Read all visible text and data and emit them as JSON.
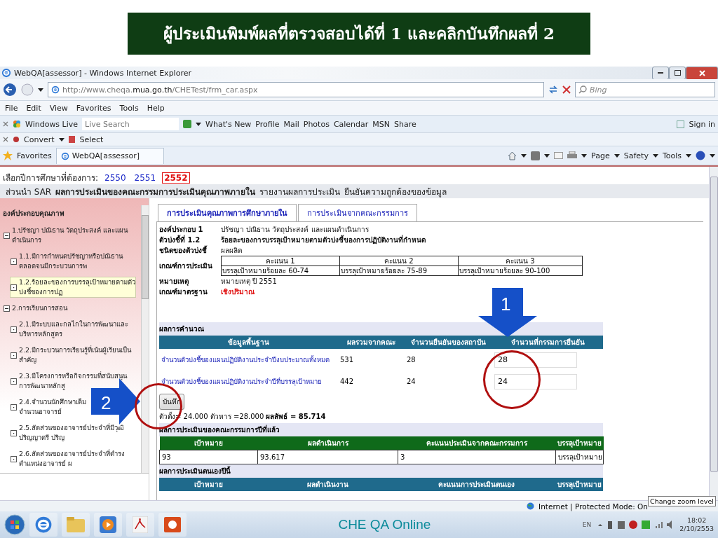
{
  "slide_title": "ผู้ประเมินพิมพ์ผลที่ตรวจสอบได้ที่ 1 และคลิกบันทึกผลที่ 2",
  "window": {
    "title": "WebQA[assessor] - Windows Internet Explorer"
  },
  "address": "http://www.cheqa.**mua.go.th**/CHETest/frm_car.aspx",
  "search": {
    "placeholder": "Bing"
  },
  "menu": [
    "File",
    "Edit",
    "View",
    "Favorites",
    "Tools",
    "Help"
  ],
  "links_bar": {
    "brand": "Windows Live",
    "search_placeholder": "Live Search",
    "links": [
      "What's New",
      "Profile",
      "Mail",
      "Photos",
      "Calendar",
      "MSN",
      "Share"
    ],
    "sign_in": "Sign in"
  },
  "convert_bar": [
    "Convert",
    "Select"
  ],
  "favorites": {
    "label": "Favorites",
    "tab": "WebQA[assessor]"
  },
  "command_bar": [
    "Page",
    "Safety",
    "Tools"
  ],
  "year_picker": {
    "label": "เลือกปีการศึกษาที่ต้องการ:",
    "years": [
      {
        "label": "2550",
        "selected": false
      },
      {
        "label": "2551",
        "selected": false
      },
      {
        "label": "2552",
        "selected": true
      }
    ]
  },
  "nav": [
    {
      "label": "ส่วนนำ SAR",
      "selected": false
    },
    {
      "label": "ผลการประเมินของคณะกรรมการประเมินคุณภาพภายใน",
      "selected": true
    },
    {
      "label": "รายงานผลการประเมิน",
      "selected": false
    },
    {
      "label": "ยืนยันความถูกต้องของข้อมูล",
      "selected": false
    }
  ],
  "sidebar": {
    "heading": "องค์ประกอบคุณภาพ",
    "items": [
      {
        "lines": [
          "1.ปรัชญา ปณิธาน วัตถุประสงค์ และแผน",
          "ดำเนินการ"
        ],
        "expanded": true,
        "children": [
          {
            "lines": [
              "1.1.มีการกำหนดปรัชญาหรือปณิธาน",
              "ตลอดจนมีกระบวนการพ"
            ],
            "selected": false
          },
          {
            "lines": [
              "1.2.ร้อยละของการบรรลุเป้าหมายตามตัว",
              "บ่งชี้ของการปฏ"
            ],
            "selected": true
          }
        ]
      },
      {
        "lines": [
          "2.การเรียนการสอน"
        ],
        "expanded": true,
        "children": [
          {
            "lines": [
              "2.1.มีระบบและกลไกในการพัฒนาและ",
              "บริหารหลักสูตร"
            ],
            "selected": false
          },
          {
            "lines": [
              "2.2.มีกระบวนการเรียนรู้ที่เน้นผู้เรียนเป็น",
              "สำคัญ"
            ],
            "selected": false
          },
          {
            "lines": [
              "2.3.มีโครงการหรือกิจกรรมที่สนับสนุน",
              "การพัฒนาหลักสู"
            ],
            "selected": false
          },
          {
            "lines": [
              "2.4.จำนวนนักศึกษาเต็ม",
              "จำนวนอาจารย์"
            ],
            "selected": false
          },
          {
            "lines": [
              "2.5.สัดส่วนของอาจารย์ประจำที่มีวุฒิ",
              "ปริญญาตรี ปริญ"
            ],
            "selected": false
          },
          {
            "lines": [
              "2.6.สัดส่วนของอาจารย์ประจำที่ดำรง",
              "ตำแหน่งอาจารย์ ผ"
            ],
            "selected": false
          }
        ]
      }
    ]
  },
  "tabs": [
    {
      "label": "การประเมินคุณภาพการศึกษาภายใน",
      "selected": true
    },
    {
      "label": "การประเมินจากคณะกรรมการ",
      "selected": false
    }
  ],
  "info": [
    {
      "kind": "text",
      "label": "องค์ประกอบ 1",
      "value": "ปรัชญา ปณิธาน วัตถุประสงค์ และแผนดำเนินการ"
    },
    {
      "kind": "strong",
      "label": "ตัวบ่งชี้ที่ 1.2",
      "value": "ร้อยละของการบรรลุเป้าหมายตามตัวบ่งชี้ของการปฏิบัติงานที่กำหนด"
    },
    {
      "kind": "text",
      "label": "ชนิดของตัวบ่งชี้",
      "value": "ผลผลิต"
    },
    {
      "kind": "criteria",
      "label": "เกณฑ์การประเมิน",
      "headers": [
        "คะแนน 1",
        "คะแนน 2",
        "คะแนน 3"
      ],
      "cells": [
        "บรรลุเป้าหมายร้อยละ 60-74",
        "บรรลุเป้าหมายร้อยละ 75-89",
        "บรรลุเป้าหมายร้อยละ 90-100"
      ]
    },
    {
      "kind": "text",
      "label": "หมายเหตุ",
      "value": "หมายเหตุ ปี 2551"
    },
    {
      "kind": "alert",
      "label": "เกณฑ์มาตรฐาน",
      "value": "เชิงปริมาณ"
    }
  ],
  "calc": {
    "heading": "ผลการคำนวณ",
    "columns": [
      "ข้อมูลพื้นฐาน",
      "ผลรวมจากคณะ",
      "จำนวนยืนยันของสถาบัน",
      "จำนวนที่กรรมการยืนยัน"
    ],
    "rows": [
      {
        "label": "จำนวนตัวบ่งชี้ของแผนปฏิบัติงานประจำปีงบประมาณทั้งหมด",
        "faculty": "531",
        "institution": "28",
        "value": "28"
      },
      {
        "label": "จำนวนตัวบ่งชี้ของแผนปฏิบัติงานประจำปีที่บรรลุเป้าหมาย",
        "faculty": "442",
        "institution": "24",
        "value": "24"
      }
    ],
    "save_button": "บันทึก",
    "result": "ตัวตั้ง= 24.000  ตัวหาร =28.000  **ผลลัพธ์ = 85.714**"
  },
  "last_year": {
    "heading": "ผลการประเมินของคณะกรรมการปีที่แล้ว",
    "columns": [
      "เป้าหมาย",
      "ผลดำเนินการ",
      "คะแนนประเมินจากคณะกรรมการ",
      "บรรลุเป้าหมาย"
    ],
    "rows": [
      [
        "93",
        "93.617",
        "3",
        "บรรลุเป้าหมาย"
      ]
    ]
  },
  "this_year": {
    "heading": "ผลการประเมินตนเองปีนี้",
    "columns": [
      "เป้าหมาย",
      "ผลดำเนินงาน",
      "คะแนนการประเมินตนเอง",
      "บรรลุเป้าหมาย"
    ]
  },
  "status": {
    "zone": "Internet | Protected Mode: On",
    "tooltip": "Change zoom level"
  },
  "footer": "CHE QA Online",
  "taskbar": {
    "lang": "EN",
    "time": "18:02",
    "date": "2/10/2553"
  },
  "callouts": [
    {
      "label": "1"
    },
    {
      "label": "2"
    }
  ]
}
